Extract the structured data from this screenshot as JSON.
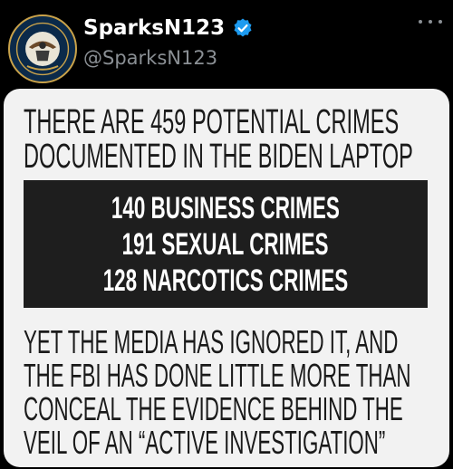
{
  "post": {
    "display_name": "SparksN123",
    "handle": "@SparksN123",
    "verified_icon": "verified-badge-icon",
    "avatar_icon": "navy-seal-emblem-icon",
    "more_icon": "more-options-icon",
    "colors": {
      "verified": "#1d9bf0",
      "handle": "#8a8f94",
      "background": "#000000"
    }
  },
  "meme": {
    "top_lines": [
      "THERE ARE 459 POTENTIAL CRIMES",
      "DOCUMENTED IN THE BIDEN LAPTOP"
    ],
    "box_lines": [
      "140 BUSINESS CRIMES",
      "191 SEXUAL CRIMES",
      "128 NARCOTICS CRIMES"
    ],
    "bottom_lines": [
      "YET THE MEDIA HAS IGNORED IT, AND",
      "THE FBI HAS DONE LITTLE MORE THAN",
      "CONCEAL THE EVIDENCE BEHIND THE",
      "VEIL OF AN “ACTIVE INVESTIGATION”"
    ]
  }
}
